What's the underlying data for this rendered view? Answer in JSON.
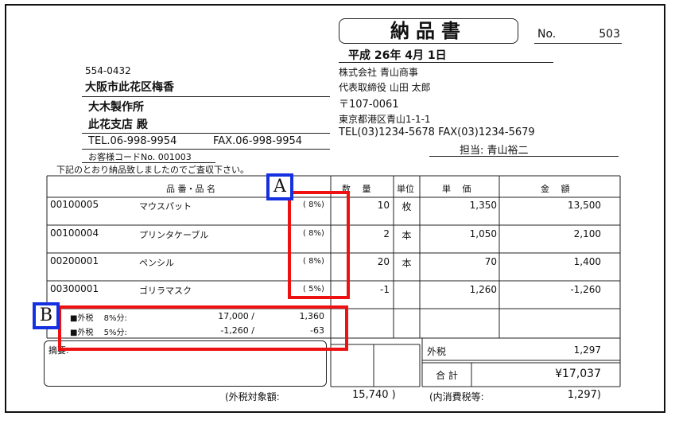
{
  "document": {
    "title": "納品書",
    "number_label": "No.",
    "number_value": "503",
    "date": "平成 26年 4月 1日",
    "recipient": {
      "postal": "554-0432",
      "address": "大阪市此花区梅香",
      "company": "大木製作所",
      "branch": "此花支店 殿",
      "tel": "TEL.06-998-9954",
      "fax": "FAX.06-998-9954",
      "customer_code": "お客様コードNo.   001003"
    },
    "notice": "下記のとおり納品致しましたのでご査収下さい。",
    "sender": {
      "company": "株式会社 青山商事",
      "representative": "代表取締役 山田 太郎",
      "postal": "〒107-0061",
      "address": "東京都港区青山1-1-1",
      "tel_fax": "TEL(03)1234-5678 FAX(03)1234-5679",
      "person": "担当: 青山裕二"
    }
  },
  "table": {
    "headers": {
      "item": "品 番・品 名",
      "qty": "数　 量",
      "unit": "単位",
      "price": "単　 価",
      "amount": "金　 額"
    },
    "rows": [
      {
        "code": "00100005",
        "name": "マウスパット",
        "tax": "( 8%)",
        "qty": "10",
        "unit": "枚",
        "price": "1,350",
        "amount": "13,500"
      },
      {
        "code": "00100004",
        "name": "プリンタケーブル",
        "tax": "( 8%)",
        "qty": "2",
        "unit": "本",
        "price": "1,050",
        "amount": "2,100"
      },
      {
        "code": "00200001",
        "name": "ペンシル",
        "tax": "( 8%)",
        "qty": "20",
        "unit": "本",
        "price": "70",
        "amount": "1,400"
      },
      {
        "code": "00300001",
        "name": "ゴリラマスク",
        "tax": "( 5%)",
        "qty": "-1",
        "unit": "",
        "price": "1,260",
        "amount": "-1,260"
      }
    ],
    "tax_breakdown": [
      {
        "label": "■外税　 8%分:",
        "base": "17,000 /",
        "tax": "1,360"
      },
      {
        "label": "■外税　 5%分:",
        "base": "-1,260 /",
        "tax": "-63"
      }
    ],
    "memo_label": "摘要:",
    "external_tax_label": "外税",
    "external_tax_value": "1,297",
    "total_label": "合 計",
    "total_value": "¥17,037",
    "taxable_label": "(外税対象額:",
    "taxable_value": "15,740 )",
    "included_tax_label": "(内消費税等:",
    "included_tax_value": "1,297)"
  },
  "annotations": {
    "a_label": "A",
    "b_label": "B",
    "highlight_color": "#ee1111",
    "label_border_color": "#1530e0"
  }
}
